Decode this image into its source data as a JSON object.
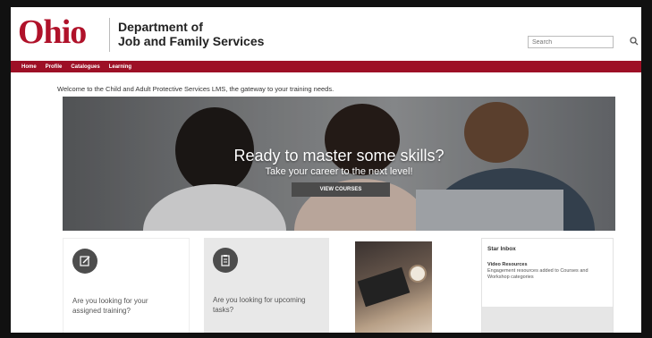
{
  "header": {
    "logo": "Ohio",
    "dept_line1": "Department of",
    "dept_line2": "Job and Family Services",
    "search_placeholder": "Search"
  },
  "nav": {
    "items": [
      "Home",
      "Profile",
      "Catalogues",
      "Learning"
    ]
  },
  "welcome": "Welcome to the Child and Adult Protective Services LMS, the gateway to your training needs.",
  "hero": {
    "title": "Ready to master some skills?",
    "subtitle": "Take your career to the next level!",
    "button": "VIEW COURSES"
  },
  "cards": {
    "assigned": "Are you looking for your assigned training?",
    "upcoming": "Are you looking for upcoming tasks?"
  },
  "sidebar": {
    "title": "Star Inbox",
    "item_title": "Video Resources",
    "item_detail": "Engagement resources added to Courses and Workshop categories"
  },
  "colors": {
    "brand": "#9d1026",
    "logo": "#b0122a"
  }
}
